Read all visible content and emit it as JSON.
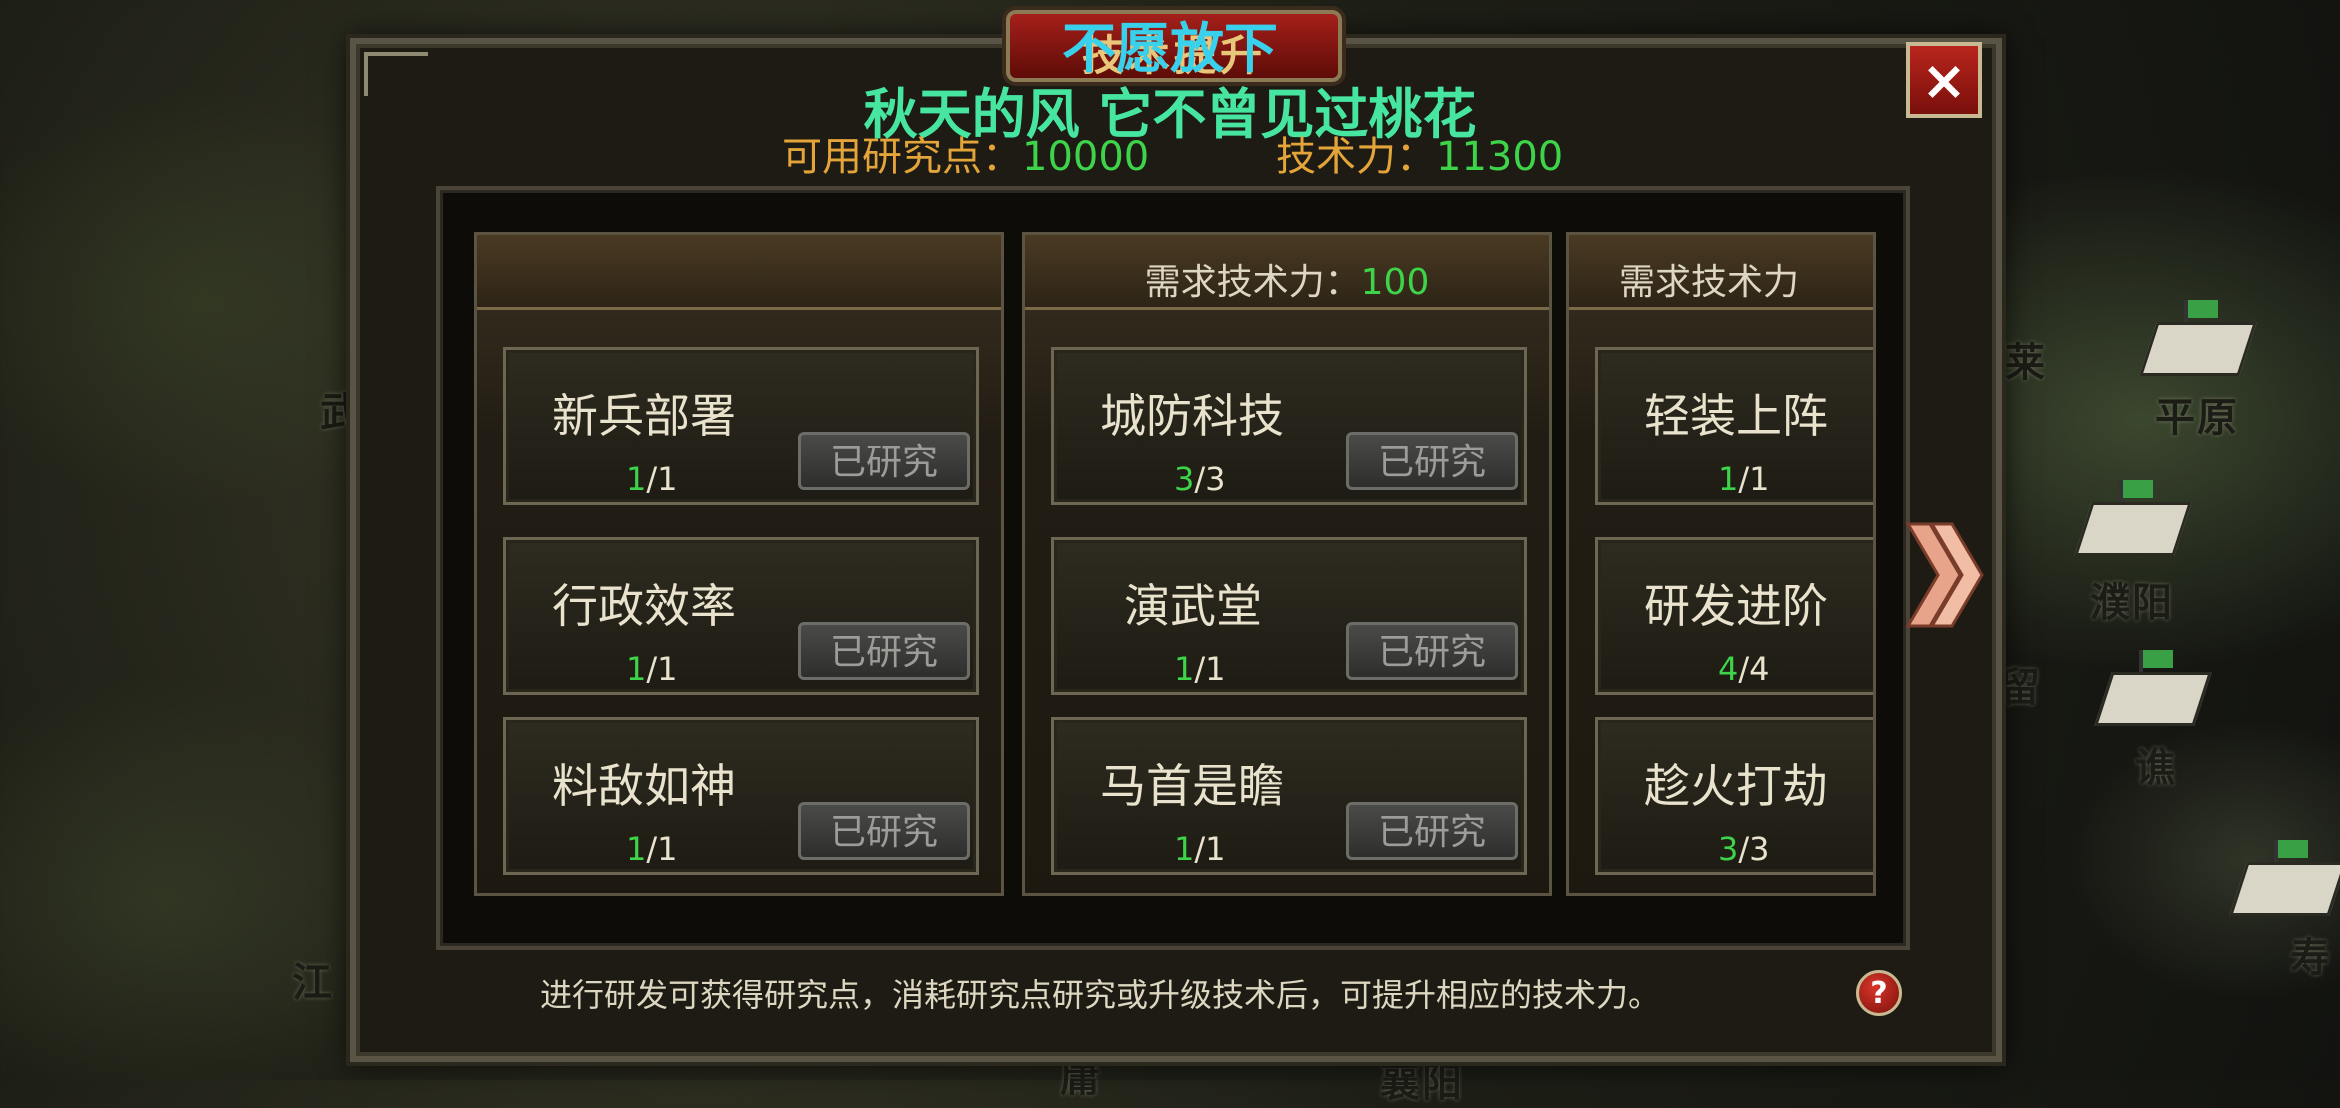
{
  "map": {
    "labels": [
      "平原",
      "濮阳",
      "留",
      "谯",
      "寿",
      "武",
      "江",
      "庸",
      "襄阳",
      "莱"
    ]
  },
  "header": {
    "title": "技术提升",
    "overlay_name": "不愿放下",
    "overlay_song": "秋天的风 它不曾见过桃花",
    "close_icon": "×"
  },
  "stats": {
    "research_points_label": "可用研究点：",
    "research_points_value": "10000",
    "tech_power_label": "技术力：",
    "tech_power_value": "11300"
  },
  "columns": [
    {
      "requirement_label": "",
      "requirement_value": "",
      "techs": [
        {
          "name": "新兵部署",
          "current": "1",
          "max": "/1",
          "button": "已研究"
        },
        {
          "name": "行政效率",
          "current": "1",
          "max": "/1",
          "button": "已研究"
        },
        {
          "name": "料敌如神",
          "current": "1",
          "max": "/1",
          "button": "已研究"
        }
      ]
    },
    {
      "requirement_label": "需求技术力：",
      "requirement_value": "100",
      "techs": [
        {
          "name": "城防科技",
          "current": "3",
          "max": "/3",
          "button": "已研究"
        },
        {
          "name": "演武堂",
          "current": "1",
          "max": "/1",
          "button": "已研究"
        },
        {
          "name": "马首是瞻",
          "current": "1",
          "max": "/1",
          "button": "已研究"
        }
      ]
    },
    {
      "requirement_label": "需求技术力",
      "requirement_value": "",
      "techs": [
        {
          "name": "轻装上阵",
          "current": "1",
          "max": "/1"
        },
        {
          "name": "研发进阶",
          "current": "4",
          "max": "/4"
        },
        {
          "name": "趁火打劫",
          "current": "3",
          "max": "/3"
        }
      ]
    }
  ],
  "footer": {
    "hint": "进行研发可获得研究点，消耗研究点研究或升级技术后，可提升相应的技术力。",
    "help_icon": "?"
  },
  "colors": {
    "accent_green": "#3ed44a",
    "label_orange": "#e3a43a",
    "close_red": "#b8251d"
  }
}
